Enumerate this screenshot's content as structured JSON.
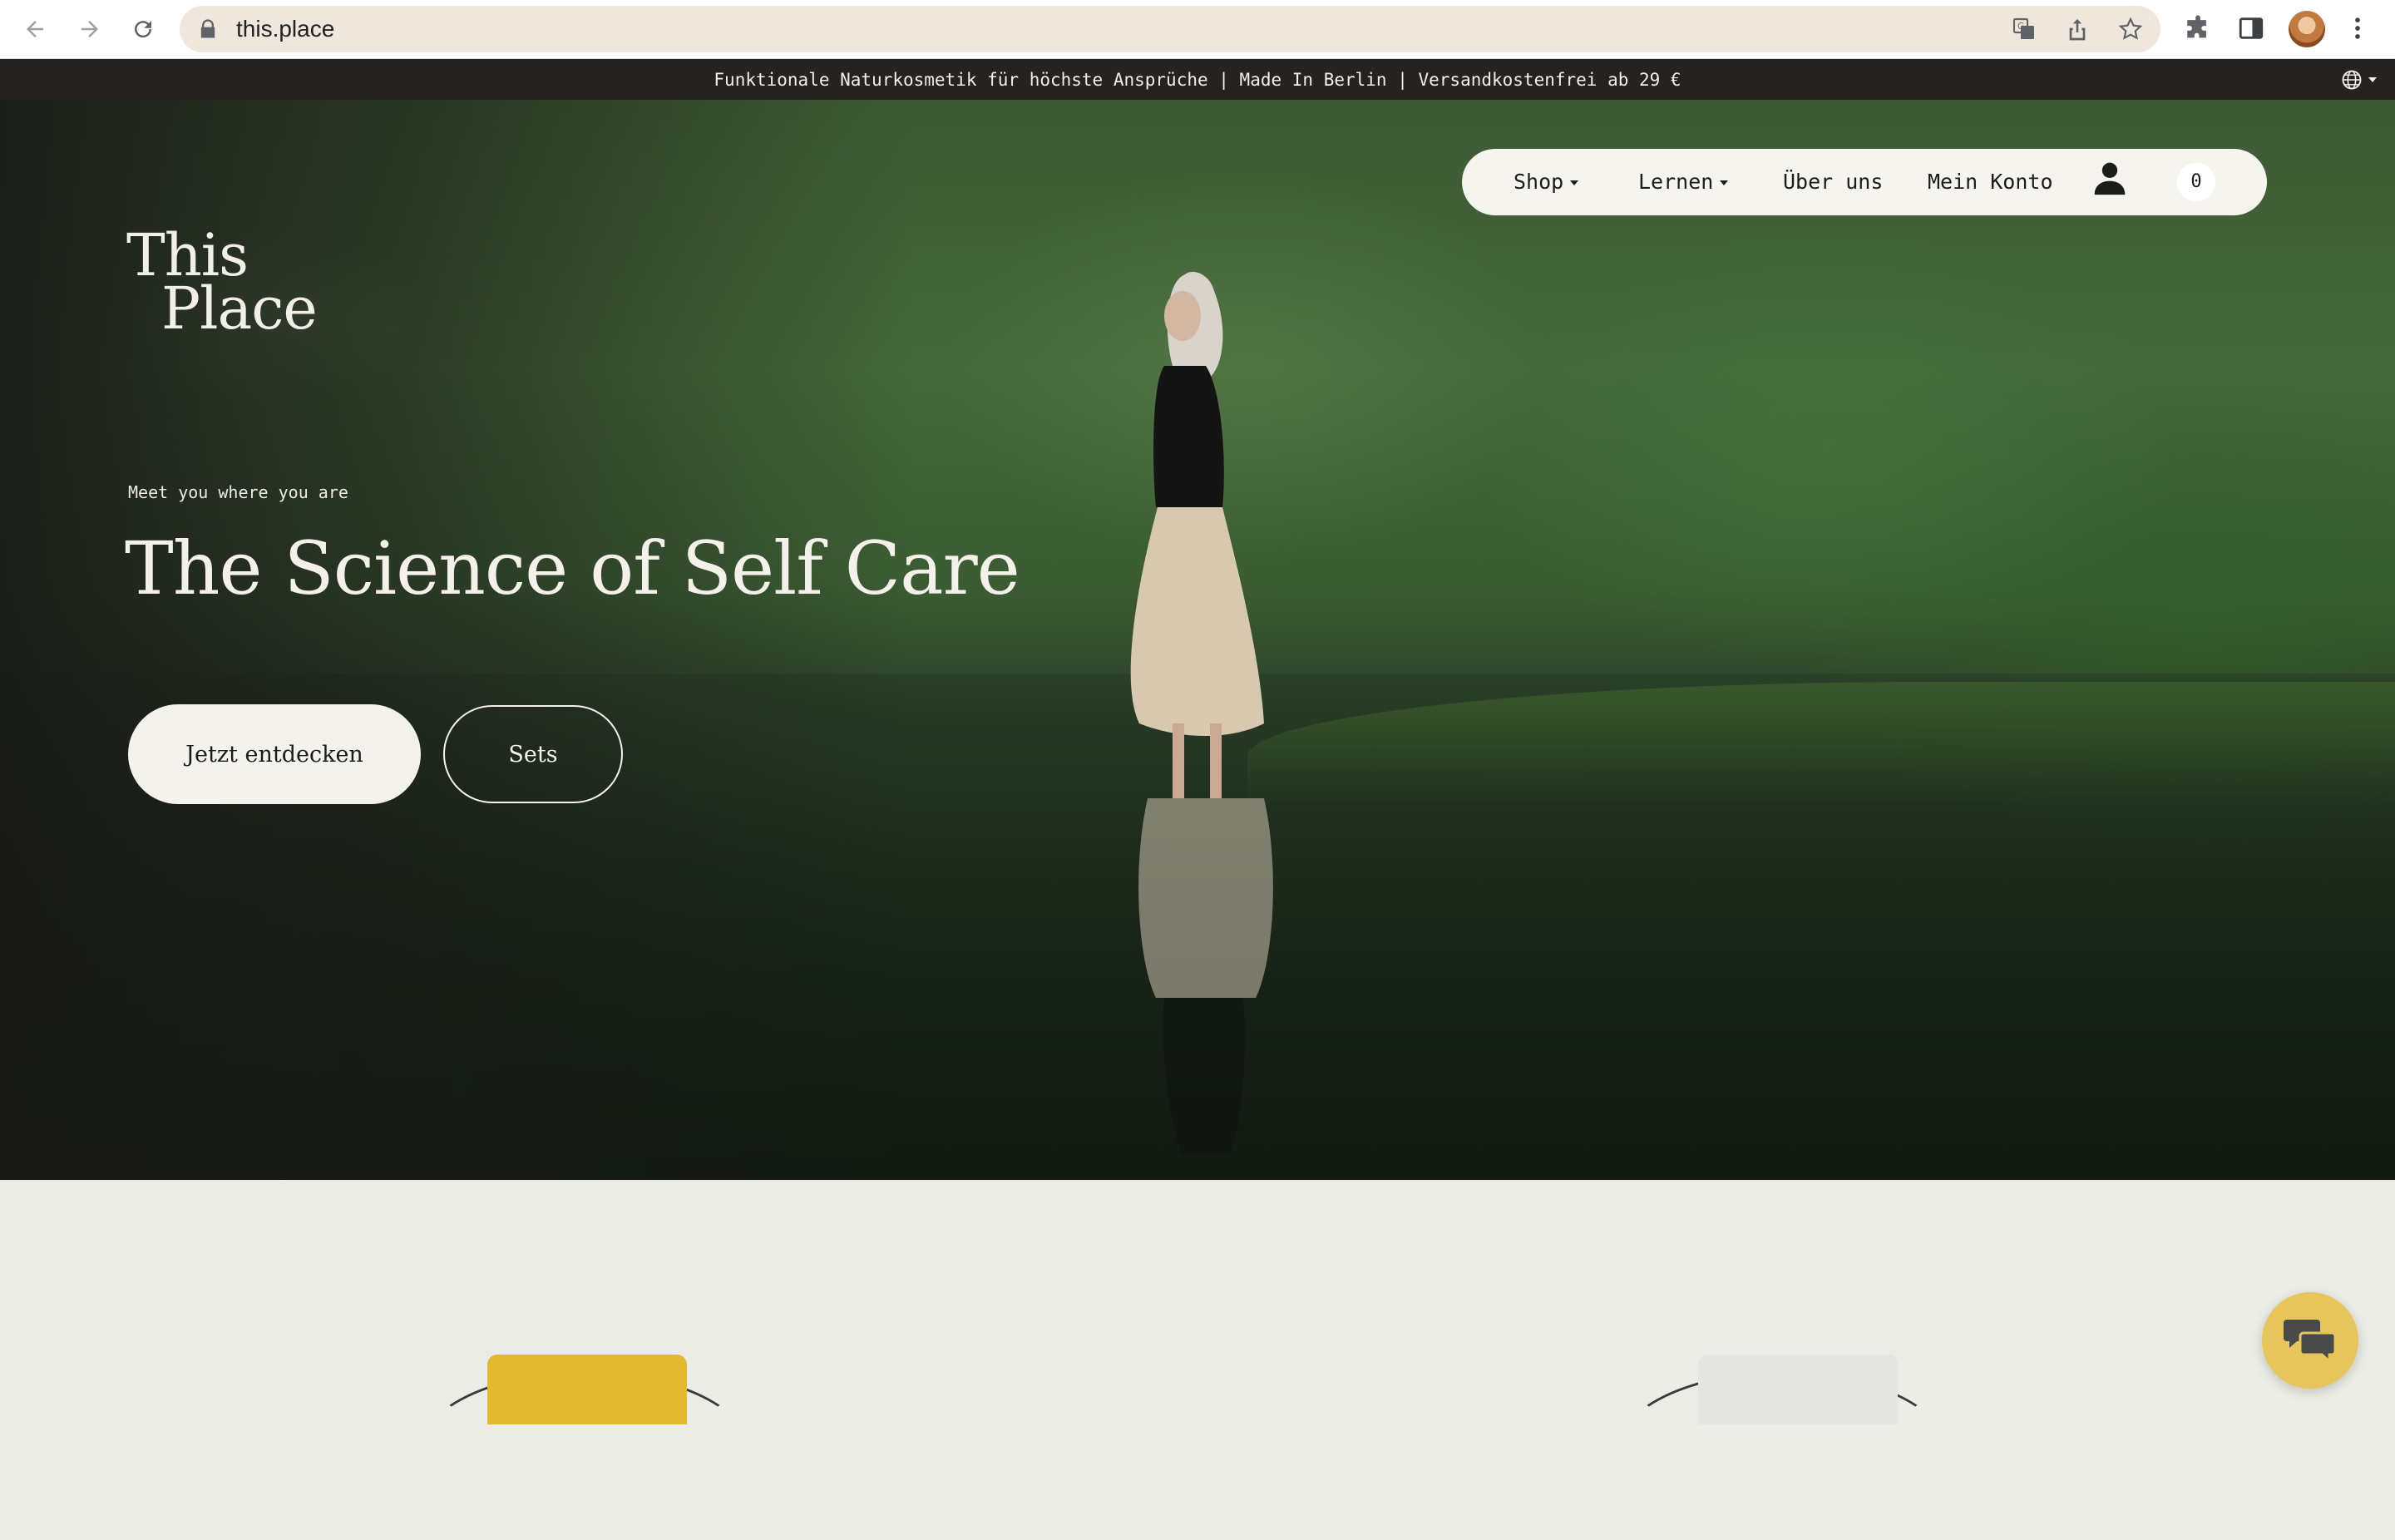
{
  "browser": {
    "url": "this.place"
  },
  "announcement": {
    "text": "Funktionale Naturkosmetik für höchste Ansprüche | Made In Berlin | Versandkostenfrei ab 29 €"
  },
  "logo": {
    "line1": "This",
    "line2": "Place"
  },
  "nav": {
    "shop": "Shop",
    "lernen": "Lernen",
    "ueber_uns": "Über uns",
    "mein_konto": "Mein Konto",
    "cart_count": "0"
  },
  "hero": {
    "eyebrow": "Meet you where you are",
    "title": "The Science of Self Care",
    "primary_cta": "Jetzt entdecken",
    "secondary_cta": "Sets"
  },
  "colors": {
    "announcement_bg": "#242321",
    "pill_bg": "#f5f4ef",
    "chat_accent": "#e6c65a",
    "product_yellow": "#e2b92f",
    "product_white": "#e4e4e0"
  },
  "icons": {
    "back": "back-arrow-icon",
    "forward": "forward-arrow-icon",
    "reload": "reload-icon",
    "lock": "lock-icon",
    "translate": "translate-icon",
    "share": "share-icon",
    "bookmark": "star-icon",
    "extensions": "puzzle-icon",
    "sidepanel": "side-panel-icon",
    "menu": "kebab-menu-icon",
    "language": "globe-icon",
    "account": "user-icon",
    "chat": "chat-bubbles-icon"
  }
}
